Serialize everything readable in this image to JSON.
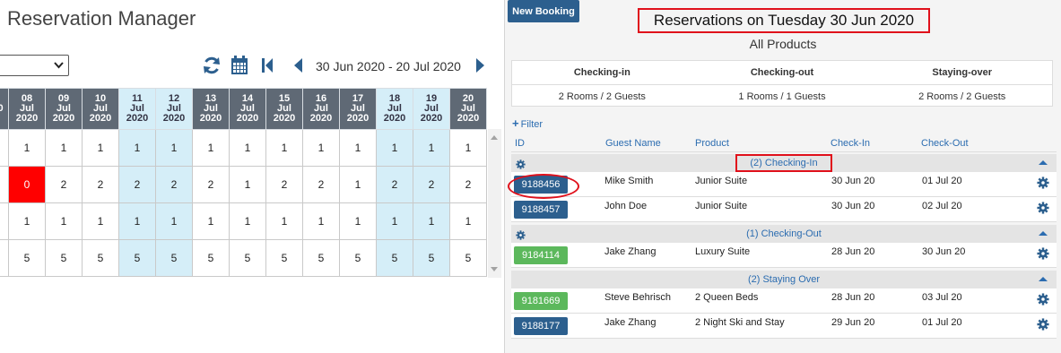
{
  "app": {
    "title": "Reservation Manager"
  },
  "toolbar": {
    "product_select_value": "",
    "date_range": "30 Jun 2020 - 20 Jul 2020",
    "icons": {
      "refresh": "refresh-icon",
      "calendar": "calendar-icon",
      "first": "first-page-icon",
      "prev": "prev-icon",
      "next": "next-icon"
    }
  },
  "grid": {
    "partial_first_header": "0",
    "columns": [
      {
        "day": "08",
        "month": "Jul",
        "year": "2020",
        "weekend": false
      },
      {
        "day": "09",
        "month": "Jul",
        "year": "2020",
        "weekend": false
      },
      {
        "day": "10",
        "month": "Jul",
        "year": "2020",
        "weekend": false
      },
      {
        "day": "11",
        "month": "Jul",
        "year": "2020",
        "weekend": true
      },
      {
        "day": "12",
        "month": "Jul",
        "year": "2020",
        "weekend": true
      },
      {
        "day": "13",
        "month": "Jul",
        "year": "2020",
        "weekend": false
      },
      {
        "day": "14",
        "month": "Jul",
        "year": "2020",
        "weekend": false
      },
      {
        "day": "15",
        "month": "Jul",
        "year": "2020",
        "weekend": false
      },
      {
        "day": "16",
        "month": "Jul",
        "year": "2020",
        "weekend": false
      },
      {
        "day": "17",
        "month": "Jul",
        "year": "2020",
        "weekend": false
      },
      {
        "day": "18",
        "month": "Jul",
        "year": "2020",
        "weekend": true
      },
      {
        "day": "19",
        "month": "Jul",
        "year": "2020",
        "weekend": true
      },
      {
        "day": "20",
        "month": "Jul",
        "year": "2020",
        "weekend": false
      }
    ],
    "rows": [
      [
        "1",
        "1",
        "1",
        "1",
        "1",
        "1",
        "1",
        "1",
        "1",
        "1",
        "1",
        "1",
        "1"
      ],
      [
        "0",
        "2",
        "2",
        "2",
        "2",
        "2",
        "1",
        "2",
        "2",
        "1",
        "2",
        "2",
        "2"
      ],
      [
        "1",
        "1",
        "1",
        "1",
        "1",
        "1",
        "1",
        "1",
        "1",
        "1",
        "1",
        "1",
        "1"
      ],
      [
        "5",
        "5",
        "5",
        "5",
        "5",
        "5",
        "5",
        "5",
        "5",
        "5",
        "5",
        "5",
        "5"
      ]
    ],
    "sold_out_cells": [
      [
        1,
        0
      ]
    ],
    "colors": {
      "header": "#5f6975",
      "weekend": "#d5eef8",
      "sold_out": "#ff0000"
    }
  },
  "panel": {
    "new_booking_label": "New Booking",
    "title": "Reservations on Tuesday 30 Jun 2020",
    "product_filter": "All Products",
    "summary": [
      {
        "label": "Checking-in",
        "value": "2 Rooms / 2 Guests"
      },
      {
        "label": "Checking-out",
        "value": "1 Rooms / 1 Guests"
      },
      {
        "label": "Staying-over",
        "value": "2 Rooms / 2 Guests"
      }
    ],
    "filter_label": "Filter",
    "columns": [
      "ID",
      "Guest Name",
      "Product",
      "Check-In",
      "Check-Out"
    ],
    "groups": [
      {
        "label": "(2) Checking-In",
        "rows": [
          {
            "id": "9188456",
            "status": "blue",
            "guest": "Mike Smith",
            "product": "Junior Suite",
            "checkin": "30 Jun 20",
            "checkout": "01 Jul 20"
          },
          {
            "id": "9188457",
            "status": "blue",
            "guest": "John Doe",
            "product": "Junior Suite",
            "checkin": "30 Jun 20",
            "checkout": "02 Jul 20"
          }
        ]
      },
      {
        "label": "(1) Checking-Out",
        "rows": [
          {
            "id": "9184114",
            "status": "green",
            "guest": "Jake Zhang",
            "product": "Luxury Suite",
            "checkin": "28 Jun 20",
            "checkout": "30 Jun 20"
          }
        ]
      },
      {
        "label": "(2) Staying Over",
        "rows": [
          {
            "id": "9181669",
            "status": "green",
            "guest": "Steve Behrisch",
            "product": "2 Queen Beds",
            "checkin": "28 Jun 20",
            "checkout": "03 Jul 20"
          },
          {
            "id": "9188177",
            "status": "blue",
            "guest": "Jake Zhang",
            "product": "2 Night Ski and Stay",
            "checkin": "29 Jun 20",
            "checkout": "01 Jul 20"
          }
        ]
      }
    ],
    "colors": {
      "primary": "#2c5f8e",
      "success": "#5cb85c",
      "link": "#2b6cb0",
      "highlight": "#e0101b"
    }
  }
}
